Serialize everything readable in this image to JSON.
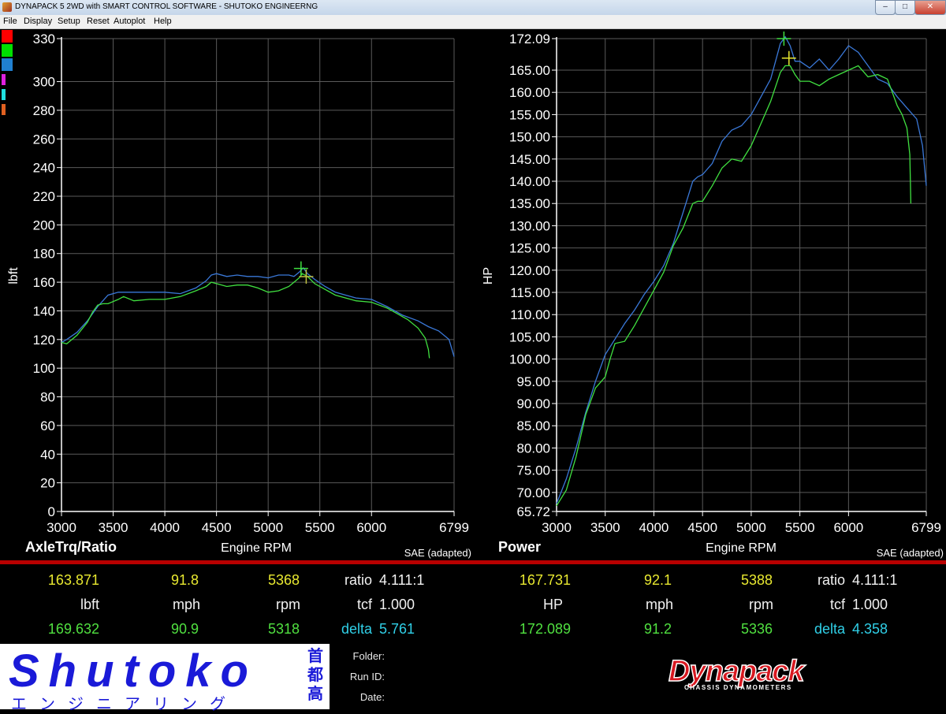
{
  "window": {
    "title": "DYNAPACK 5 2WD with SMART CONTROL SOFTWARE - SHUTOKO ENGINEERNG",
    "controls": [
      "–",
      "□",
      "✕"
    ]
  },
  "menu": [
    "File",
    "Display",
    "Setup",
    "Reset",
    "Autoplot",
    "Help"
  ],
  "legend_colors": [
    "#ff0000",
    "#00e000",
    "#2080d0",
    "#e020e0",
    "#20e0e0",
    "#e06020"
  ],
  "chart_data": [
    {
      "type": "line",
      "title": "AxleTrq/Ratio",
      "xlabel": "Engine RPM",
      "ylabel": "lbft",
      "note": "SAE (adapted)",
      "xlim": [
        3000,
        6799
      ],
      "ylim": [
        0,
        330
      ],
      "x_ticks": [
        3000,
        3500,
        4000,
        4500,
        5000,
        5500,
        6000,
        6799
      ],
      "y_ticks": [
        0,
        20,
        40,
        60,
        80,
        100,
        120,
        140,
        160,
        180,
        200,
        220,
        240,
        260,
        280,
        300,
        330
      ],
      "y_tick_labels": [
        "0",
        "20",
        "40",
        "60",
        "80",
        "100",
        "120",
        "140",
        "160",
        "180",
        "200",
        "220",
        "240",
        "260",
        "280",
        "300",
        "330"
      ],
      "grid": true,
      "series": [
        {
          "color": "#3a78d8",
          "x": [
            3000,
            3050,
            3150,
            3250,
            3350,
            3450,
            3550,
            3700,
            3850,
            4000,
            4150,
            4300,
            4400,
            4450,
            4500,
            4600,
            4700,
            4800,
            4900,
            5000,
            5100,
            5200,
            5250,
            5300,
            5340,
            5380,
            5450,
            5550,
            5650,
            5750,
            5850,
            6000,
            6150,
            6300,
            6450,
            6550,
            6650,
            6750,
            6799
          ],
          "y": [
            118,
            120,
            125,
            133,
            143,
            151,
            153,
            153,
            153,
            153,
            152,
            156,
            161,
            165,
            166,
            164,
            165,
            164,
            164,
            163,
            165,
            165,
            164,
            167,
            170,
            166,
            162,
            157,
            153,
            151,
            149,
            148,
            143,
            137,
            133,
            129,
            126,
            120,
            108
          ]
        },
        {
          "color": "#40e040",
          "x": [
            3000,
            3050,
            3150,
            3250,
            3300,
            3350,
            3400,
            3450,
            3550,
            3600,
            3700,
            3850,
            4000,
            4150,
            4300,
            4400,
            4450,
            4500,
            4600,
            4700,
            4800,
            4900,
            5000,
            5100,
            5200,
            5250,
            5300,
            5330,
            5380,
            5450,
            5550,
            5650,
            5750,
            5850,
            6000,
            6150,
            6250,
            6350,
            6450,
            6520,
            6550,
            6560
          ],
          "y": [
            118,
            117,
            123,
            132,
            139,
            144,
            145,
            145,
            148,
            150,
            147,
            148,
            148,
            150,
            154,
            157,
            160,
            159,
            157,
            158,
            158,
            156,
            153,
            154,
            157,
            160,
            163,
            166,
            164,
            159,
            155,
            151,
            149,
            147,
            146,
            142,
            138,
            134,
            128,
            121,
            113,
            107
          ]
        }
      ],
      "markers": [
        {
          "color": "#40e040",
          "x": 5318,
          "y": 169.6
        },
        {
          "color": "#c0c040",
          "x": 5368,
          "y": 163.9
        }
      ]
    },
    {
      "type": "line",
      "title": "Power",
      "xlabel": "Engine RPM",
      "ylabel": "HP",
      "note": "SAE (adapted)",
      "xlim": [
        3000,
        6799
      ],
      "ylim": [
        65.72,
        172.09
      ],
      "x_ticks": [
        3000,
        3500,
        4000,
        4500,
        5000,
        5500,
        6000,
        6799
      ],
      "y_ticks": [
        65.72,
        70,
        75,
        80,
        85,
        90,
        95,
        100,
        105,
        110,
        115,
        120,
        125,
        130,
        135,
        140,
        145,
        150,
        155,
        160,
        165,
        172.09
      ],
      "y_tick_labels": [
        "65.72",
        "70.00",
        "75.00",
        "80.00",
        "85.00",
        "90.00",
        "95.00",
        "100.00",
        "105.00",
        "110.00",
        "115.00",
        "120.00",
        "125.00",
        "130.00",
        "135.00",
        "140.00",
        "145.00",
        "150.00",
        "155.00",
        "160.00",
        "165.00",
        "172.09"
      ],
      "grid": true,
      "series": [
        {
          "color": "#3a78d8",
          "x": [
            3000,
            3100,
            3200,
            3300,
            3400,
            3500,
            3600,
            3700,
            3800,
            3900,
            4000,
            4100,
            4200,
            4300,
            4400,
            4450,
            4500,
            4600,
            4700,
            4800,
            4900,
            5000,
            5100,
            5200,
            5250,
            5300,
            5350,
            5400,
            5450,
            5500,
            5600,
            5700,
            5800,
            5900,
            6000,
            6100,
            6200,
            6300,
            6400,
            6500,
            6600,
            6700,
            6760,
            6799
          ],
          "y": [
            67.5,
            73,
            80,
            88,
            95,
            101,
            104.5,
            108,
            111,
            114.5,
            117.5,
            121,
            126,
            133,
            140,
            141,
            141.5,
            144,
            149,
            151.5,
            152.5,
            155,
            159,
            163,
            167,
            171,
            172.5,
            170.5,
            167,
            167,
            165.5,
            167.5,
            165,
            167.5,
            170.5,
            169,
            166,
            163,
            162,
            159,
            156.5,
            154,
            148,
            139
          ]
        },
        {
          "color": "#40e040",
          "x": [
            3000,
            3100,
            3200,
            3300,
            3400,
            3500,
            3550,
            3600,
            3700,
            3800,
            3900,
            4000,
            4100,
            4200,
            4300,
            4400,
            4450,
            4500,
            4600,
            4700,
            4800,
            4900,
            5000,
            5100,
            5200,
            5300,
            5350,
            5400,
            5450,
            5500,
            5600,
            5700,
            5800,
            5900,
            6000,
            6100,
            6200,
            6300,
            6350,
            6400,
            6450,
            6500,
            6550,
            6600,
            6630,
            6640
          ],
          "y": [
            67,
            70.5,
            78,
            87.5,
            93.5,
            96,
            100,
            103.5,
            104,
            107.5,
            111.5,
            115.5,
            119.5,
            125.5,
            129.5,
            135,
            135.5,
            135.5,
            139,
            143,
            145,
            144.5,
            148,
            153,
            158,
            164.5,
            166,
            166,
            164,
            162.5,
            162.5,
            161.5,
            163,
            164,
            165,
            166,
            163.5,
            164,
            163.5,
            163,
            160,
            157,
            155,
            152,
            146,
            135
          ]
        }
      ],
      "markers": [
        {
          "color": "#40e040",
          "x": 5336,
          "y": 172.09
        },
        {
          "color": "#e8e830",
          "x": 5388,
          "y": 167.7
        }
      ]
    }
  ],
  "readouts": {
    "left": {
      "cursor_values": [
        "163.871",
        "91.8",
        "5368"
      ],
      "units": [
        "lbft",
        "mph",
        "rpm"
      ],
      "peak_values": [
        "169.632",
        "90.9",
        "5318"
      ],
      "ratio_label": "ratio",
      "ratio_value": "4.111:1",
      "tcf_label": "tcf",
      "tcf_value": "1.000",
      "delta_label": "delta",
      "delta_value": "5.761"
    },
    "right": {
      "cursor_values": [
        "167.731",
        "92.1",
        "5388"
      ],
      "units": [
        "HP",
        "mph",
        "rpm"
      ],
      "peak_values": [
        "172.089",
        "91.2",
        "5336"
      ],
      "ratio_label": "ratio",
      "ratio_value": "4.111:1",
      "tcf_label": "tcf",
      "tcf_value": "1.000",
      "delta_label": "delta",
      "delta_value": "4.358"
    }
  },
  "shutoko_logo": {
    "text": "Shutoko",
    "katakana": "エンジニアリング",
    "kanji": [
      "首",
      "都",
      "高"
    ]
  },
  "run_meta": {
    "folder_label": "Folder:",
    "runid_label": "Run ID:",
    "date_label": "Date:"
  },
  "dynapack_logo": {
    "text": "Dynapack",
    "subtitle": "CHASSIS DYNAMOMETERS"
  }
}
